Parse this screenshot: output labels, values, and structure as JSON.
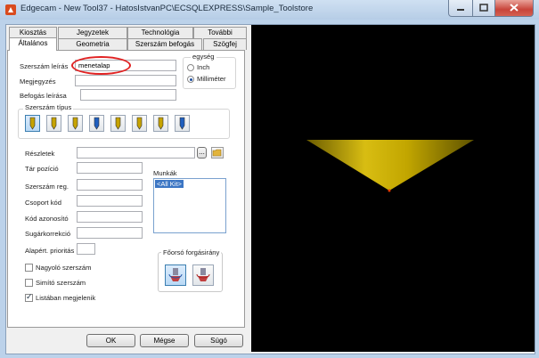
{
  "window": {
    "title": "Edgecam - New Tool37 - HatosIstvanPC\\ECSQLEXPRESS\\Sample_Toolstore"
  },
  "tabs_back": [
    "Kiosztás",
    "Jegyzetek",
    "Technológia",
    "További"
  ],
  "tabs_front": [
    "Általános",
    "Geometria",
    "Szerszám befogás",
    "Szögfej"
  ],
  "general": {
    "tool_desc_label": "Szerszám leírás",
    "tool_desc_value": "menetalap",
    "note_label": "Megjegyzés",
    "holder_desc_label": "Befogás leírása",
    "unit_label": "egység",
    "unit_inch": "Inch",
    "unit_mm": "Milliméter",
    "tool_type_label": "Szerszám típus",
    "details_label": "Részletek",
    "details_btn": "...",
    "mag_pos_label": "Tár pozíció",
    "tool_reg_label": "Szerszám reg.",
    "group_code_label": "Csoport kód",
    "id_code_label": "Kód azonosító",
    "radius_comp_label": "Sugárkorrekció",
    "default_prio_label": "Alapért. prioritás",
    "jobs_label": "Munkák",
    "jobs_items": [
      "<All Kit>"
    ],
    "spindle_label": "Főorsó forgásirány",
    "roughing_label": "Nagyoló szerszám",
    "finishing_label": "Simító szerszám",
    "in_list_label": "Listában megjelenik"
  },
  "buttons": {
    "ok": "OK",
    "cancel": "Mégse",
    "help": "Súgó"
  },
  "state": {
    "unit_selected": "Milliméter",
    "roughing": false,
    "finishing": false,
    "in_list": true
  },
  "colors": {
    "tool_preview": "#c9ae00",
    "viewport_bg": "#000000",
    "highlight": "#e12222"
  }
}
